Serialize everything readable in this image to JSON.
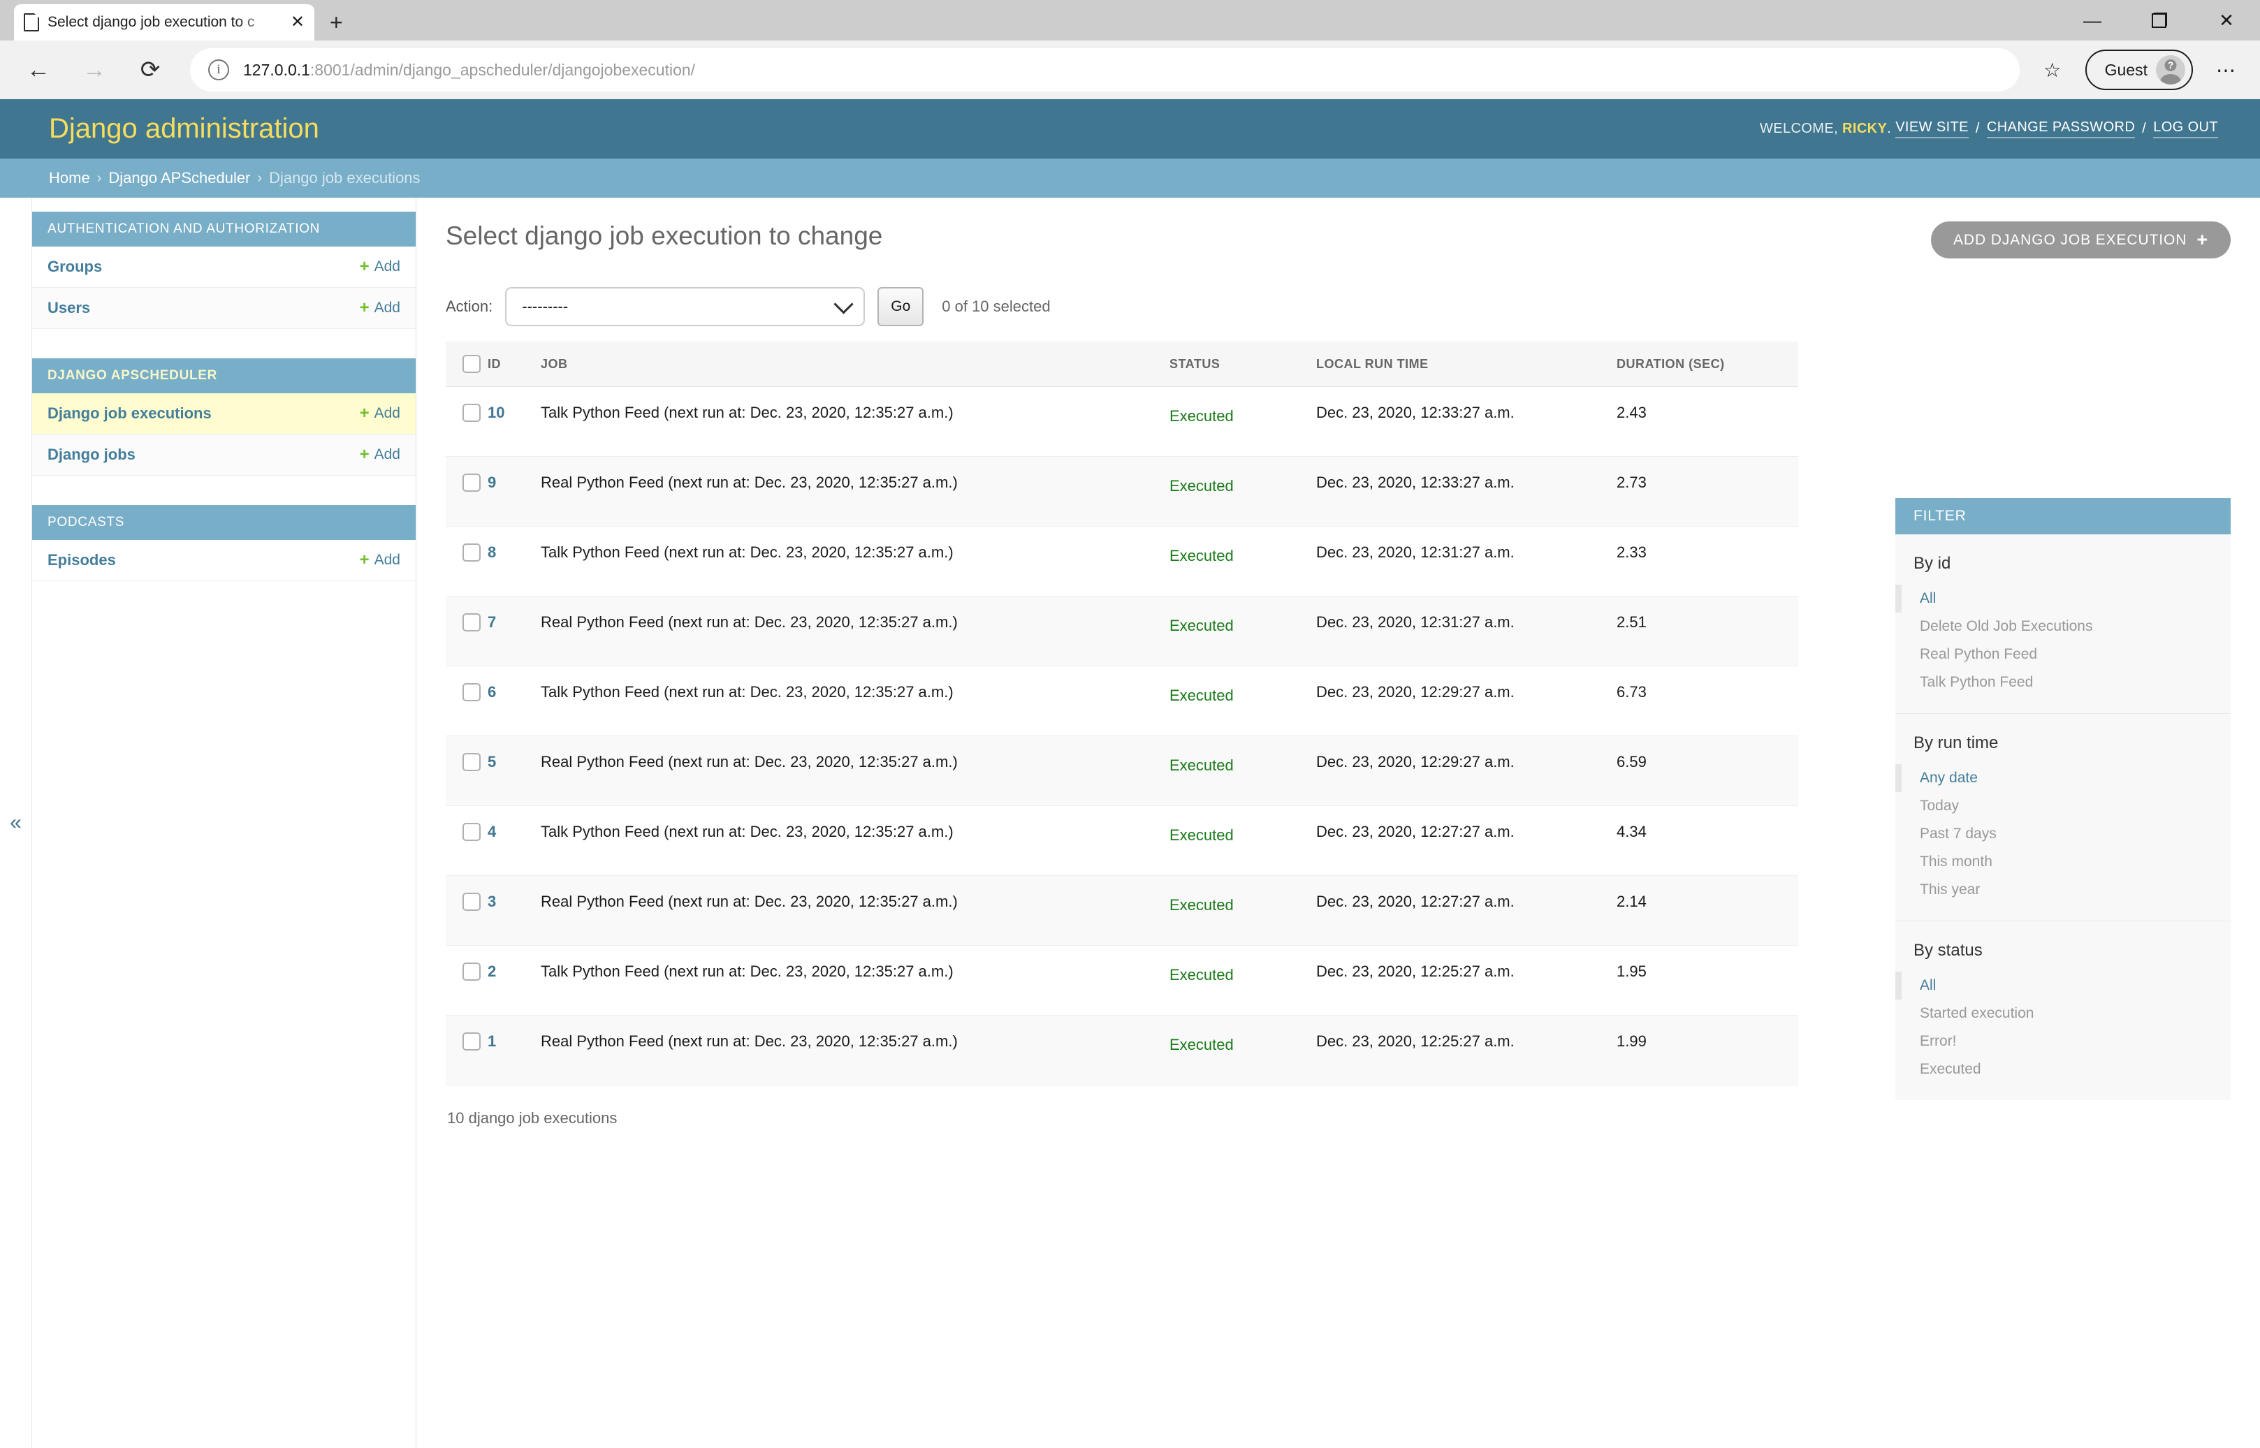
{
  "browser": {
    "tab": {
      "title": "Select django job execution to c",
      "icon": "page-icon",
      "close": "✕"
    },
    "new_tab": "+",
    "window_controls": {
      "minimize": "—",
      "maximize": "maximize-icon",
      "close": "✕"
    },
    "nav": {
      "back": "←",
      "forward": "→",
      "reload": "⟳"
    },
    "omnibox": {
      "info_icon": "i",
      "host": "127.0.0.1",
      "path": ":8001/admin/django_apscheduler/djangojobexecution/",
      "full_url": "127.0.0.1:8001/admin/django_apscheduler/djangojobexecution/"
    },
    "favorites_icon": "☆",
    "profile": {
      "name": "Guest",
      "avatar_badge": "?"
    },
    "more_menu": "⋯"
  },
  "header": {
    "branding": "Django administration",
    "welcome_prefix": "WELCOME,",
    "username": "RICKY",
    "period": ".",
    "links": [
      {
        "label": "VIEW SITE"
      },
      {
        "label": "CHANGE PASSWORD"
      },
      {
        "label": "LOG OUT"
      }
    ],
    "separator": "/"
  },
  "breadcrumbs": {
    "items": [
      {
        "label": "Home",
        "current": false
      },
      {
        "label": "Django APScheduler",
        "current": false
      },
      {
        "label": "Django job executions",
        "current": true
      }
    ],
    "separator": "›"
  },
  "sidebar": {
    "collapse_icon": "«",
    "add_label": "Add",
    "plus": "+",
    "modules": [
      {
        "caption": "AUTHENTICATION AND AUTHORIZATION",
        "bold": false,
        "rows": [
          {
            "label": "Groups",
            "current": false
          },
          {
            "label": "Users",
            "current": false
          }
        ]
      },
      {
        "caption": "DJANGO APSCHEDULER",
        "bold": true,
        "rows": [
          {
            "label": "Django job executions",
            "current": true
          },
          {
            "label": "Django jobs",
            "current": false
          }
        ]
      },
      {
        "caption": "PODCASTS",
        "bold": false,
        "rows": [
          {
            "label": "Episodes",
            "current": false
          }
        ]
      }
    ]
  },
  "main": {
    "title": "Select django job execution to change",
    "add_button": {
      "label": "ADD DJANGO JOB EXECUTION",
      "plus": "+"
    },
    "actions": {
      "label": "Action:",
      "selected": "---------",
      "go_label": "Go",
      "counter": "0 of 10 selected"
    },
    "table": {
      "columns": [
        "ID",
        "JOB",
        "STATUS",
        "LOCAL RUN TIME",
        "DURATION (SEC)"
      ],
      "rows": [
        {
          "id": "10",
          "job": "Talk Python Feed (next run at: Dec. 23, 2020, 12:35:27 a.m.)",
          "status": "Executed",
          "run_time": "Dec. 23, 2020, 12:33:27 a.m.",
          "duration": "2.43"
        },
        {
          "id": "9",
          "job": "Real Python Feed (next run at: Dec. 23, 2020, 12:35:27 a.m.)",
          "status": "Executed",
          "run_time": "Dec. 23, 2020, 12:33:27 a.m.",
          "duration": "2.73"
        },
        {
          "id": "8",
          "job": "Talk Python Feed (next run at: Dec. 23, 2020, 12:35:27 a.m.)",
          "status": "Executed",
          "run_time": "Dec. 23, 2020, 12:31:27 a.m.",
          "duration": "2.33"
        },
        {
          "id": "7",
          "job": "Real Python Feed (next run at: Dec. 23, 2020, 12:35:27 a.m.)",
          "status": "Executed",
          "run_time": "Dec. 23, 2020, 12:31:27 a.m.",
          "duration": "2.51"
        },
        {
          "id": "6",
          "job": "Talk Python Feed (next run at: Dec. 23, 2020, 12:35:27 a.m.)",
          "status": "Executed",
          "run_time": "Dec. 23, 2020, 12:29:27 a.m.",
          "duration": "6.73"
        },
        {
          "id": "5",
          "job": "Real Python Feed (next run at: Dec. 23, 2020, 12:35:27 a.m.)",
          "status": "Executed",
          "run_time": "Dec. 23, 2020, 12:29:27 a.m.",
          "duration": "6.59"
        },
        {
          "id": "4",
          "job": "Talk Python Feed (next run at: Dec. 23, 2020, 12:35:27 a.m.)",
          "status": "Executed",
          "run_time": "Dec. 23, 2020, 12:27:27 a.m.",
          "duration": "4.34"
        },
        {
          "id": "3",
          "job": "Real Python Feed (next run at: Dec. 23, 2020, 12:35:27 a.m.)",
          "status": "Executed",
          "run_time": "Dec. 23, 2020, 12:27:27 a.m.",
          "duration": "2.14"
        },
        {
          "id": "2",
          "job": "Talk Python Feed (next run at: Dec. 23, 2020, 12:35:27 a.m.)",
          "status": "Executed",
          "run_time": "Dec. 23, 2020, 12:25:27 a.m.",
          "duration": "1.95"
        },
        {
          "id": "1",
          "job": "Real Python Feed (next run at: Dec. 23, 2020, 12:35:27 a.m.)",
          "status": "Executed",
          "run_time": "Dec. 23, 2020, 12:25:27 a.m.",
          "duration": "1.99"
        }
      ]
    },
    "result_count": "10 django job executions"
  },
  "filter": {
    "heading": "FILTER",
    "sections": [
      {
        "title": "By id",
        "options": [
          {
            "label": "All",
            "selected": true
          },
          {
            "label": "Delete Old Job Executions",
            "selected": false
          },
          {
            "label": "Real Python Feed",
            "selected": false
          },
          {
            "label": "Talk Python Feed",
            "selected": false
          }
        ]
      },
      {
        "title": "By run time",
        "options": [
          {
            "label": "Any date",
            "selected": true
          },
          {
            "label": "Today",
            "selected": false
          },
          {
            "label": "Past 7 days",
            "selected": false
          },
          {
            "label": "This month",
            "selected": false
          },
          {
            "label": "This year",
            "selected": false
          }
        ]
      },
      {
        "title": "By status",
        "options": [
          {
            "label": "All",
            "selected": true
          },
          {
            "label": "Started execution",
            "selected": false
          },
          {
            "label": "Error!",
            "selected": false
          },
          {
            "label": "Executed",
            "selected": false
          }
        ]
      }
    ]
  },
  "colors": {
    "header_bg": "#417690",
    "breadcrumb_bg": "#79aec8",
    "brand_yellow": "#f5dd5d",
    "link_blue": "#447e9b",
    "status_green": "#1a7a1a",
    "add_green": "#70bf2b",
    "current_row": "#fffccf"
  }
}
